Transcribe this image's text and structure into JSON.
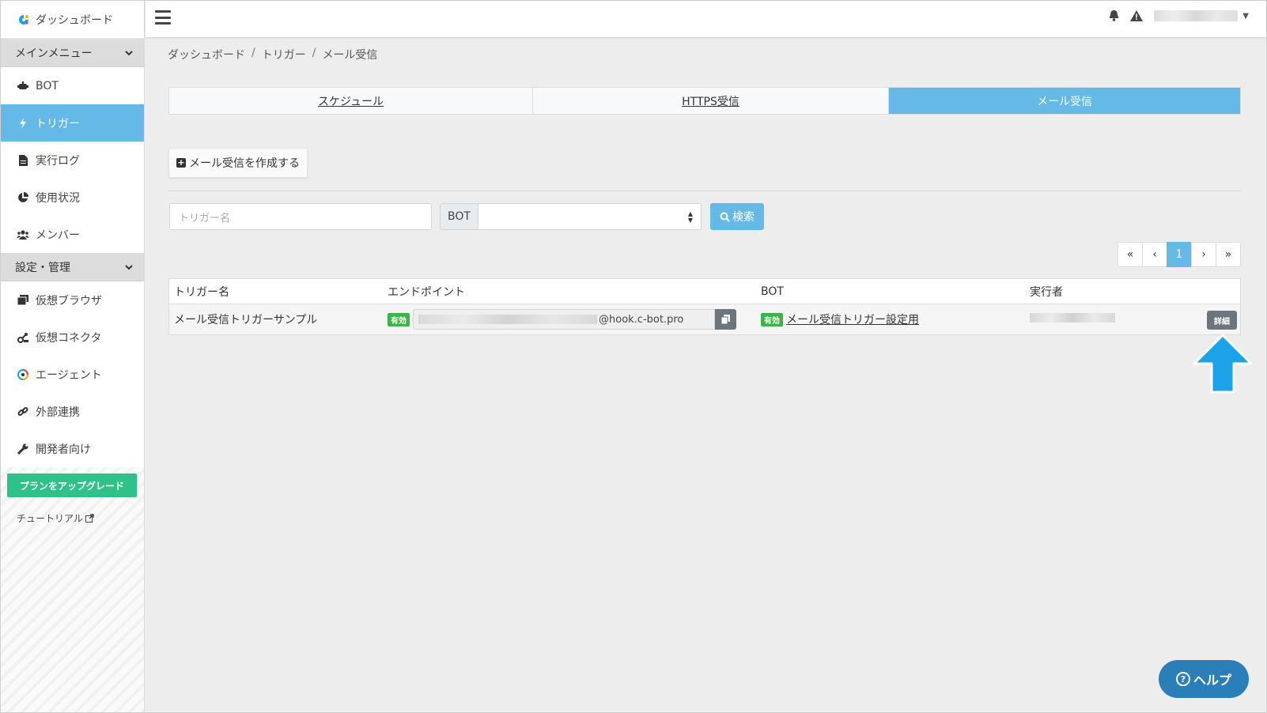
{
  "brand": {
    "title": "ダッシュボード"
  },
  "sidebar": {
    "section_main": "メインメニュー",
    "section_settings": "設定・管理",
    "items": [
      {
        "label": "BOT",
        "icon": "robot-icon"
      },
      {
        "label": "トリガー",
        "icon": "bolt-icon",
        "active": true
      },
      {
        "label": "実行ログ",
        "icon": "file-icon"
      },
      {
        "label": "使用状況",
        "icon": "pie-chart-icon"
      },
      {
        "label": "メンバー",
        "icon": "users-icon"
      }
    ],
    "settings_items": [
      {
        "label": "仮想ブラウザ",
        "icon": "browser-icon"
      },
      {
        "label": "仮想コネクタ",
        "icon": "connector-icon"
      },
      {
        "label": "エージェント",
        "icon": "agent-icon"
      },
      {
        "label": "外部連携",
        "icon": "link-icon"
      },
      {
        "label": "開発者向け",
        "icon": "wrench-icon"
      }
    ],
    "upgrade_label": "プランをアップグレード",
    "tutorial_label": "チュートリアル"
  },
  "breadcrumb": [
    "ダッシュボード",
    "トリガー",
    "メール受信"
  ],
  "tabs": [
    {
      "label": "スケジュール"
    },
    {
      "label": "HTTPS受信"
    },
    {
      "label": "メール受信",
      "active": true
    }
  ],
  "create_button": "メール受信を作成する",
  "filter": {
    "name_placeholder": "トリガー名",
    "bot_prefix": "BOT",
    "search_label": "検索"
  },
  "pagination": {
    "first": "«",
    "prev": "‹",
    "current": "1",
    "next": "›",
    "last": "»"
  },
  "table": {
    "headers": [
      "トリガー名",
      "エンドポイント",
      "BOT",
      "実行者"
    ],
    "rows": [
      {
        "name": "メール受信トリガーサンプル",
        "endpoint_badge": "有効",
        "endpoint_domain": "@hook.c-bot.pro",
        "bot_badge": "有効",
        "bot_name": "メール受信トリガー設定用",
        "detail_label": "詳細"
      }
    ]
  },
  "help_label": "ヘルプ",
  "colors": {
    "accent": "#64b9e6",
    "success": "#3cb34a",
    "upgrade": "#2ec28a",
    "help": "#2b7fb8",
    "arrow": "#1aa3e8"
  }
}
